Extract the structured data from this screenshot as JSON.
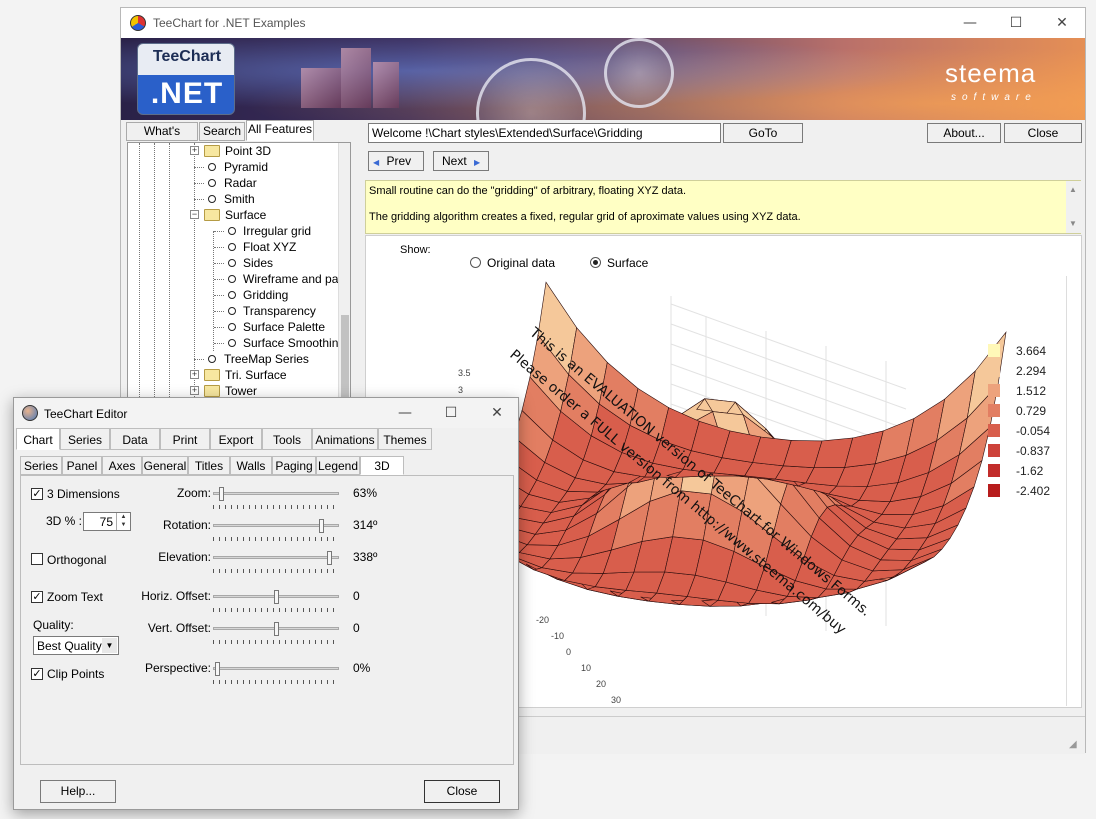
{
  "main": {
    "title": "TeeChart for .NET Examples",
    "caption": {
      "minimize": "—",
      "maximize": "☐",
      "close": "✕"
    },
    "banner": {
      "logo_top": "TeeChart",
      "logo_bottom": ".NET",
      "brand": "steema",
      "brand_sub": "software"
    },
    "tabs": [
      {
        "label": "What's New?"
      },
      {
        "label": "Search"
      },
      {
        "label": "All Features"
      }
    ],
    "tree": {
      "items": [
        {
          "label": "Point 3D",
          "type": "folder",
          "expander": "+"
        },
        {
          "label": "Pyramid",
          "type": "leaf"
        },
        {
          "label": "Radar",
          "type": "leaf"
        },
        {
          "label": "Smith",
          "type": "leaf"
        },
        {
          "label": "Surface",
          "type": "folder",
          "expander": "−"
        },
        {
          "label": "Irregular grid",
          "type": "leaf"
        },
        {
          "label": "Float XYZ",
          "type": "leaf"
        },
        {
          "label": "Sides",
          "type": "leaf"
        },
        {
          "label": "Wireframe and palet",
          "type": "leaf"
        },
        {
          "label": "Gridding",
          "type": "leaf"
        },
        {
          "label": "Transparency",
          "type": "leaf"
        },
        {
          "label": "Surface Palette",
          "type": "leaf"
        },
        {
          "label": "Surface Smoothing",
          "type": "leaf"
        },
        {
          "label": "TreeMap Series",
          "type": "leaf"
        },
        {
          "label": "Tri. Surface",
          "type": "folder",
          "expander": "+"
        },
        {
          "label": "Tower",
          "type": "folder",
          "expander": "+"
        }
      ]
    },
    "address": "Welcome !\\Chart styles\\Extended\\Surface\\Gridding",
    "goto_label": "GoTo",
    "about_label": "About...",
    "close_label": "Close",
    "prev_label": "Prev",
    "next_label": "Next",
    "description": [
      "Small routine can do the \"gridding\" of arbitrary, floating XYZ data.",
      "The gridding algorithm creates a fixed, regular grid of aproximate values using XYZ data."
    ],
    "show_label": "Show:",
    "radio_original": "Original data",
    "radio_surface": "Surface",
    "radio_selected": "surface",
    "watermark": [
      "This is an EVALUATION version of TeeChart for Windows Forms.",
      "Please order a FULL version from http://www.steema.com/buy"
    ],
    "colors": {
      "surface_dark": "#c0211f",
      "surface_light": "#fff7b0",
      "banner_accent": "#e58f55"
    }
  },
  "chart_data": {
    "type": "surface",
    "z_axis_ticks": [
      "3.5",
      "3"
    ],
    "x_axis_ticks": [
      "-20",
      "-10",
      "0",
      "10",
      "20",
      "30"
    ],
    "legend": {
      "placement": "right",
      "entries": [
        {
          "label": "3.664",
          "color": "#fff8b8"
        },
        {
          "label": "2.294",
          "color": "#f5c89a"
        },
        {
          "label": "1.512",
          "color": "#eda27c"
        },
        {
          "label": "0.729",
          "color": "#e27e62"
        },
        {
          "label": "-0.054",
          "color": "#d85e4c"
        },
        {
          "label": "-0.837",
          "color": "#cd423a"
        },
        {
          "label": "-1.62",
          "color": "#c22c2a"
        },
        {
          "label": "-2.402",
          "color": "#b71c1c"
        }
      ]
    },
    "grid": true
  },
  "editor": {
    "title": "TeeChart Editor",
    "caption": {
      "minimize": "—",
      "maximize": "☐",
      "close": "✕"
    },
    "main_tabs": [
      {
        "label": "Chart"
      },
      {
        "label": "Series"
      },
      {
        "label": "Data"
      },
      {
        "label": "Print"
      },
      {
        "label": "Export"
      },
      {
        "label": "Tools"
      },
      {
        "label": "Animations"
      },
      {
        "label": "Themes"
      }
    ],
    "sub_tabs": [
      {
        "label": "Series"
      },
      {
        "label": "Panel"
      },
      {
        "label": "Axes"
      },
      {
        "label": "General"
      },
      {
        "label": "Titles"
      },
      {
        "label": "Walls"
      },
      {
        "label": "Paging"
      },
      {
        "label": "Legend"
      },
      {
        "label": "3D"
      }
    ],
    "three_d": {
      "dimensions_label": "3 Dimensions",
      "dimensions_checked": true,
      "percent_label": "3D % :",
      "percent_value": "75",
      "orthogonal_label": "Orthogonal",
      "orthogonal_checked": false,
      "zoom_text_label": "Zoom Text",
      "zoom_text_checked": true,
      "quality_label": "Quality:",
      "quality_value": "Best Quality",
      "clip_points_label": "Clip Points",
      "clip_points_checked": true,
      "sliders": [
        {
          "label": "Zoom:",
          "value_text": "63%",
          "position": 0.05
        },
        {
          "label": "Rotation:",
          "value_text": "314º",
          "position": 0.88
        },
        {
          "label": "Elevation:",
          "value_text": "338º",
          "position": 0.94
        },
        {
          "label": "Horiz. Offset:",
          "value_text": "0",
          "position": 0.5
        },
        {
          "label": "Vert. Offset:",
          "value_text": "0",
          "position": 0.5
        },
        {
          "label": "Perspective:",
          "value_text": "0%",
          "position": 0.02
        }
      ]
    },
    "help_label": "Help...",
    "close_label": "Close"
  }
}
